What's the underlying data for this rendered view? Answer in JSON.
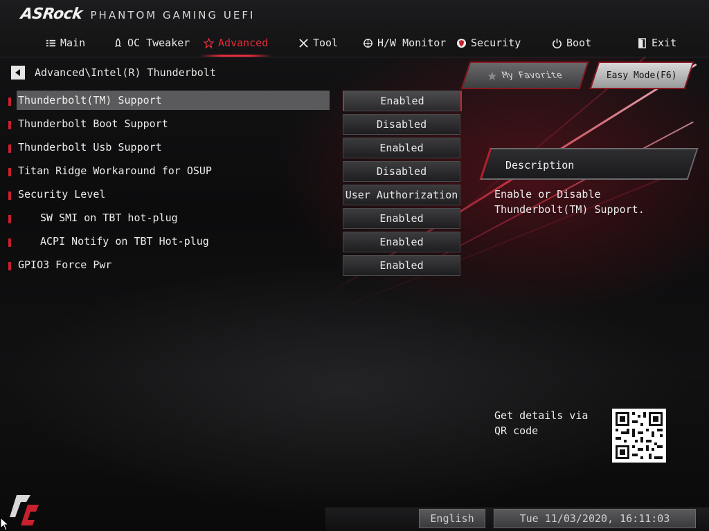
{
  "app": {
    "brand": "ASRock",
    "subtitle": "PHANTOM GAMING UEFI"
  },
  "nav": {
    "tabs": [
      {
        "label": "Main",
        "icon": "list-icon"
      },
      {
        "label": "OC Tweaker",
        "icon": "rocket-icon"
      },
      {
        "label": "Advanced",
        "icon": "star-icon",
        "active": true
      },
      {
        "label": "Tool",
        "icon": "tools-icon"
      },
      {
        "label": "H/W Monitor",
        "icon": "crosshair-icon"
      },
      {
        "label": "Security",
        "icon": "shield-icon"
      },
      {
        "label": "Boot",
        "icon": "power-icon"
      },
      {
        "label": "Exit",
        "icon": "exit-door-icon"
      }
    ]
  },
  "breadcrumb": "Advanced\\Intel(R) Thunderbolt",
  "buttons": {
    "favorite": "My Favorite",
    "easy_mode": "Easy Mode(F6)"
  },
  "settings": [
    {
      "label": "Thunderbolt(TM) Support",
      "value": "Enabled",
      "selected": true
    },
    {
      "label": "Thunderbolt Boot Support",
      "value": "Disabled"
    },
    {
      "label": "Thunderbolt Usb Support",
      "value": "Enabled"
    },
    {
      "label": "Titan Ridge Workaround for OSUP",
      "value": "Disabled"
    },
    {
      "label": "Security Level",
      "value": "User Authorization"
    },
    {
      "label": "SW SMI on TBT hot-plug",
      "value": "Enabled",
      "indent": true
    },
    {
      "label": "ACPI Notify on TBT Hot-plug",
      "value": "Enabled",
      "indent": true
    },
    {
      "label": "GPIO3 Force Pwr",
      "value": "Enabled"
    }
  ],
  "description": {
    "title": "Description",
    "text": "Enable or Disable Thunderbolt(TM) Support."
  },
  "qr": {
    "text": "Get details via QR code"
  },
  "footer": {
    "language": "English",
    "datetime": "Tue 11/03/2020, 16:11:03"
  },
  "colors": {
    "accent": "#e32b3a",
    "selected_row": "#5a5a5c"
  }
}
